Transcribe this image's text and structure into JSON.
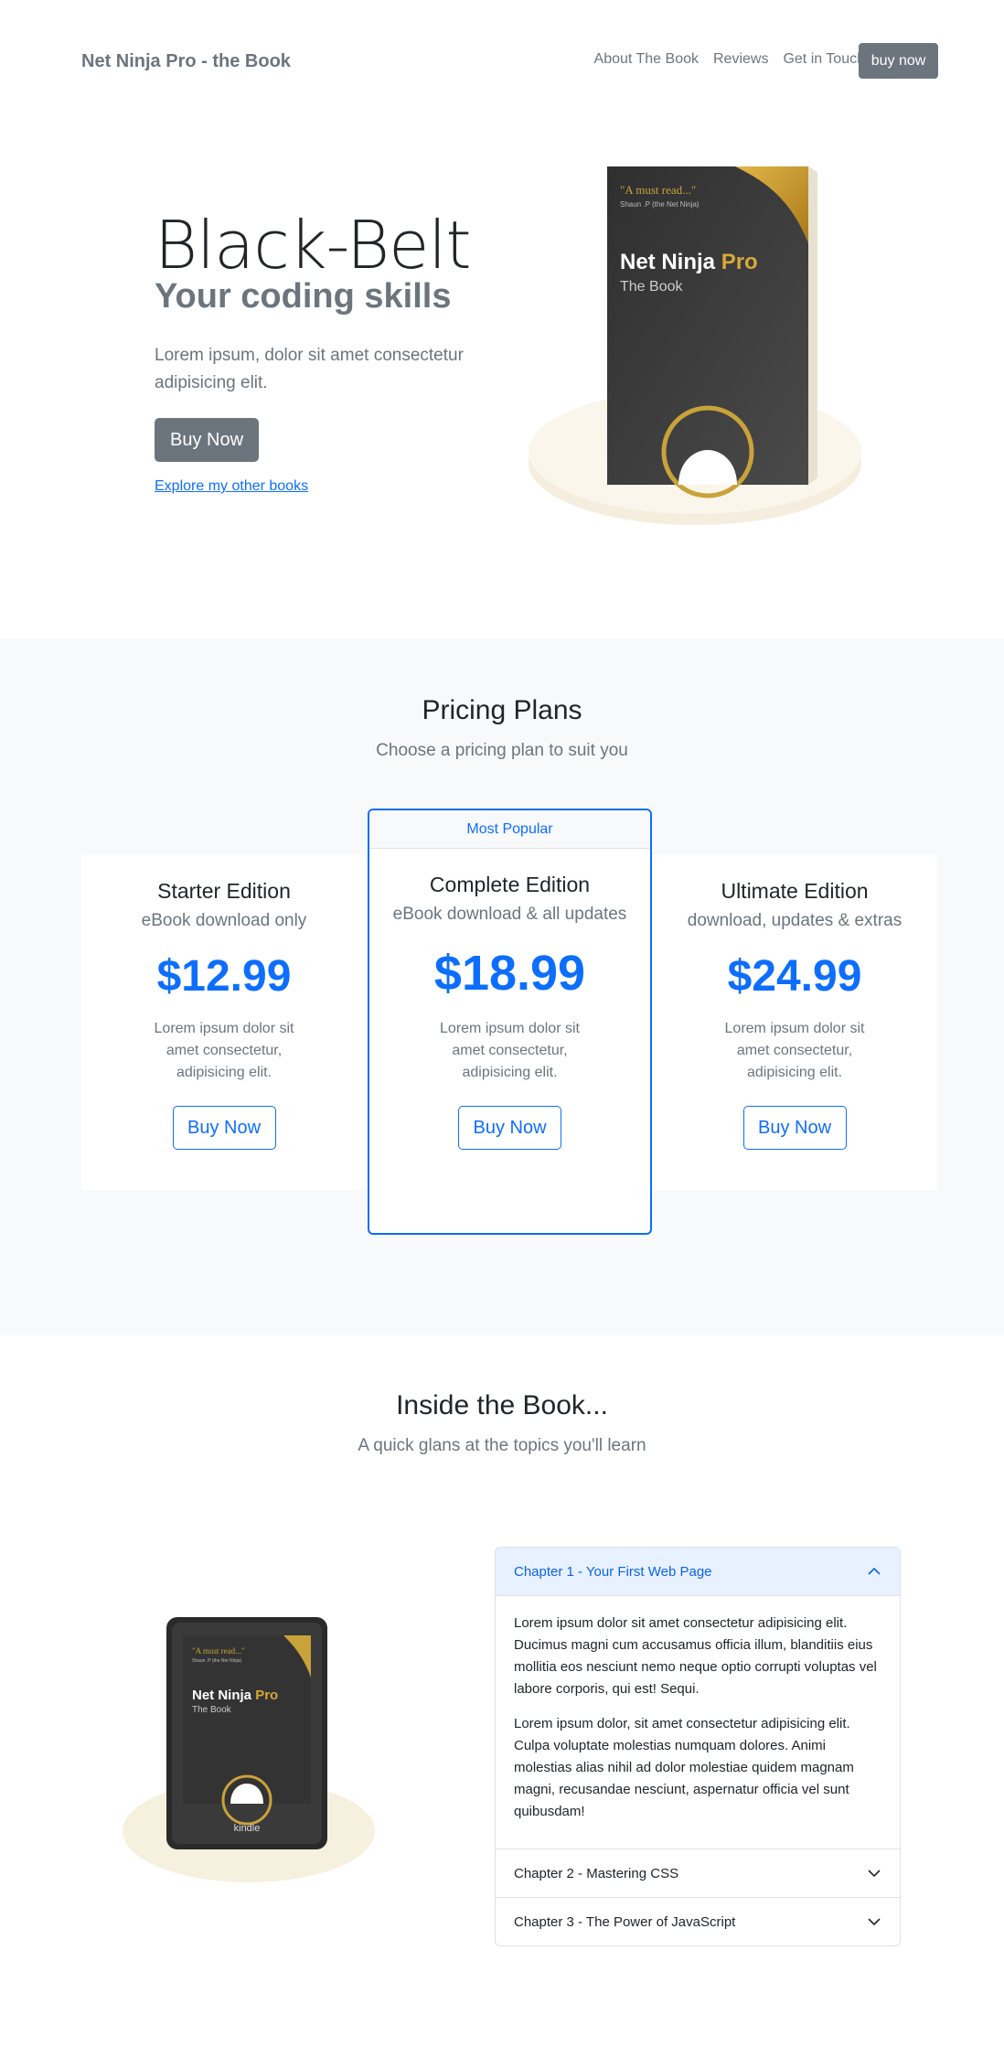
{
  "nav": {
    "brand": "Net Ninja Pro - the Book",
    "links": [
      "About The Book",
      "Reviews",
      "Get in Touch"
    ],
    "cta": "buy now"
  },
  "hero": {
    "title": "Black-Belt",
    "subtitle": "Your coding skills",
    "lead": "Lorem ipsum, dolor sit amet consectetur adipisicing elit.",
    "buy_label": "Buy Now",
    "link_label": "Explore my other books",
    "book": {
      "quote": "\"A must read...\"",
      "quote_by": "Shaun .P (the Net Ninja)",
      "title_a": "Net Ninja ",
      "title_b": "Pro",
      "subtitle": "The Book"
    }
  },
  "pricing": {
    "title": "Pricing Plans",
    "subtitle": "Choose a pricing plan to suit you",
    "plans": [
      {
        "name": "Starter Edition",
        "desc": "eBook download only",
        "price": "$12.99",
        "text": "Lorem ipsum dolor sit amet consectetur, adipisicing elit.",
        "button": "Buy Now"
      },
      {
        "badge": "Most Popular",
        "name": "Complete Edition",
        "desc": "eBook download & all updates",
        "price": "$18.99",
        "text": "Lorem ipsum dolor sit amet consectetur, adipisicing elit.",
        "button": "Buy Now"
      },
      {
        "name": "Ultimate Edition",
        "desc": "download, updates & extras",
        "price": "$24.99",
        "text": "Lorem ipsum dolor sit amet consectetur, adipisicing elit.",
        "button": "Buy Now"
      }
    ]
  },
  "inside": {
    "title": "Inside the Book...",
    "subtitle": "A quick glans at the topics you'll learn",
    "kindle_label": "kindle",
    "chapters": [
      {
        "title": "Chapter 1 - Your First Web Page",
        "open": true,
        "paragraphs": [
          "Lorem ipsum dolor sit amet consectetur adipisicing elit. Ducimus magni cum accusamus officia illum, blanditiis eius mollitia eos nesciunt nemo neque optio corrupti voluptas vel labore corporis, qui est! Sequi.",
          "Lorem ipsum dolor, sit amet consectetur adipisicing elit. Culpa voluptate molestias numquam dolores. Animi molestias alias nihil ad dolor molestiae quidem magnam magni, recusandae nesciunt, aspernatur officia vel sunt quibusdam!"
        ]
      },
      {
        "title": "Chapter 2 - Mastering CSS",
        "open": false
      },
      {
        "title": "Chapter 3 - The Power of JavaScript",
        "open": false
      }
    ]
  },
  "colors": {
    "primary": "#0d6efd",
    "secondary": "#6c757d",
    "light": "#f8f9fa",
    "gold": "#c9a23a"
  }
}
